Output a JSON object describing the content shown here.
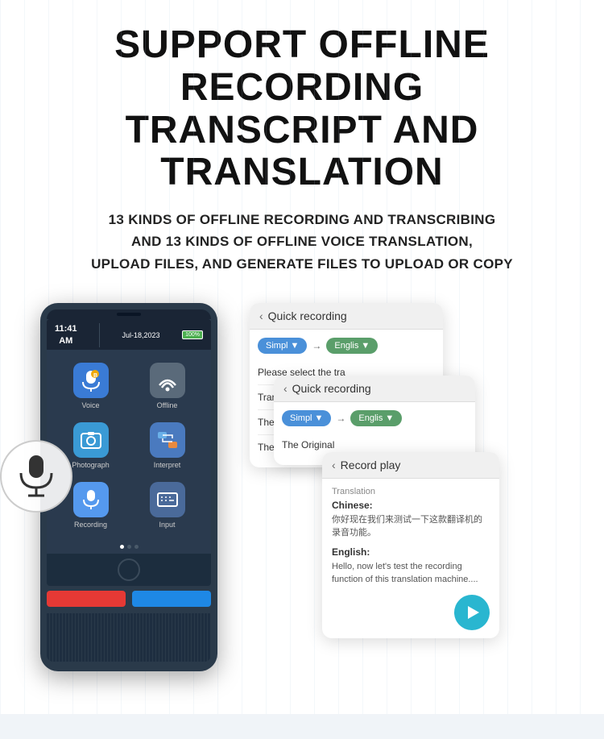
{
  "header": {
    "main_title_line1": "SUPPORT OFFLINE RECORDING",
    "main_title_line2": "TRANSCRIPT AND TRANSLATION",
    "subtitle": "13 KINDS OF OFFLINE RECORDING AND TRANSCRIBING\nAND 13 KINDS OF OFFLINE VOICE TRANSLATION,\nUPLOAD FILES, AND GENERATE FILES TO UPLOAD OR COPY"
  },
  "device": {
    "time": "11:41\nAM",
    "date": "Jul-18,2023",
    "battery": "100%",
    "apps": [
      {
        "label": "Voice",
        "icon": "🎤",
        "type": "voice-icon"
      },
      {
        "label": "Offline",
        "icon": "📶",
        "type": "offline-icon"
      },
      {
        "label": "Photograph",
        "icon": "📷",
        "type": "photo-icon"
      },
      {
        "label": "Interpret",
        "icon": "🔄",
        "type": "interpret-icon"
      },
      {
        "label": "Recording",
        "icon": "🎙️",
        "type": "recording-icon"
      },
      {
        "label": "Input",
        "icon": "⌨️",
        "type": "input-icon"
      }
    ]
  },
  "panel1": {
    "title": "Quick recording",
    "lang_from": "Simpl",
    "lang_to": "Englis",
    "row1": "Please select the tra",
    "row2": "Translation",
    "row3": "The Original",
    "row4": "The tra"
  },
  "panel2": {
    "title": "Quick recording",
    "lang_from": "Simpl",
    "lang_to": "Englis",
    "row1": "The Original"
  },
  "panel3": {
    "title": "Record play",
    "translation_label": "Translation",
    "chinese_label": "Chinese:",
    "chinese_text": "你好现在我们来测试一下这款翻译机的录音功能。",
    "english_label": "English:",
    "english_text": "Hello, now let's test the recording function of this translation machine...."
  }
}
